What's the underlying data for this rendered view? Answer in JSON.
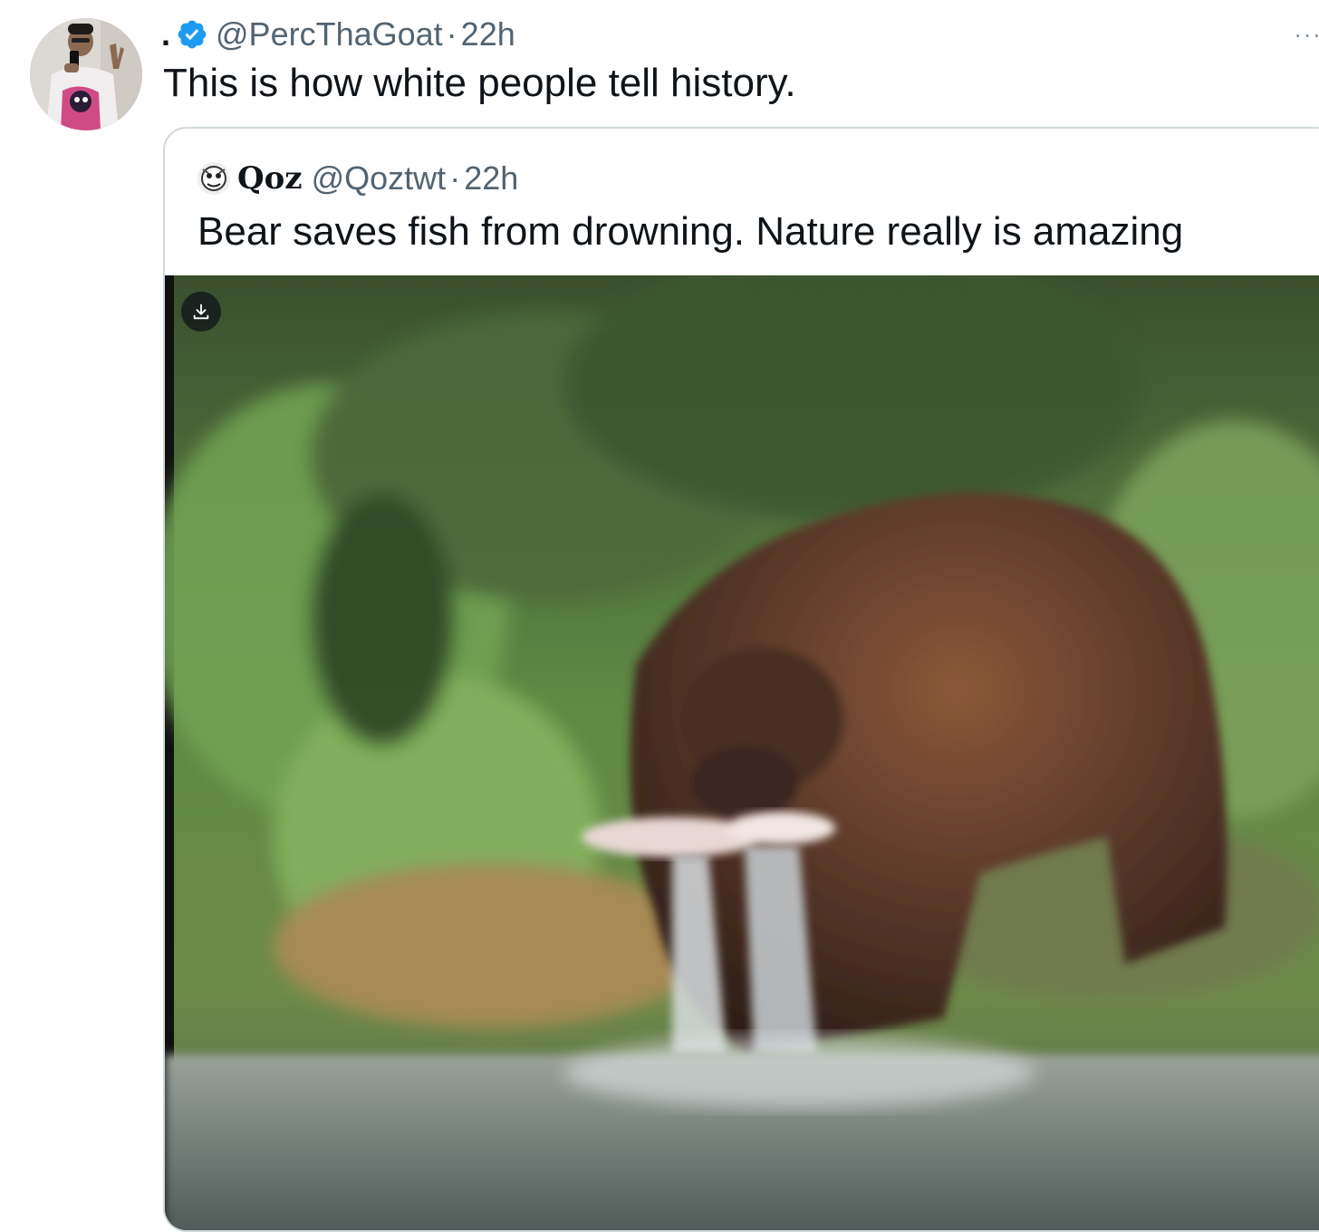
{
  "tweet": {
    "display_name": ".",
    "handle": "@PercThaGoat",
    "separator": "·",
    "time": "22h",
    "text": "This is how white people tell history.",
    "more_label": "···",
    "icons": {
      "verified": "verified-badge-icon",
      "more": "more-options-icon"
    }
  },
  "quote": {
    "display_name": "Qoz",
    "handle": "@Qoztwt",
    "separator": "·",
    "time": "22h",
    "text": "Bear saves fish from drowning. Nature really is amazing",
    "media": {
      "type": "video",
      "download_icon": "download-icon"
    }
  },
  "colors": {
    "text_primary": "#0f1419",
    "text_secondary": "#536471",
    "verified_blue": "#1d9bf0",
    "card_border": "#cfd9de"
  }
}
